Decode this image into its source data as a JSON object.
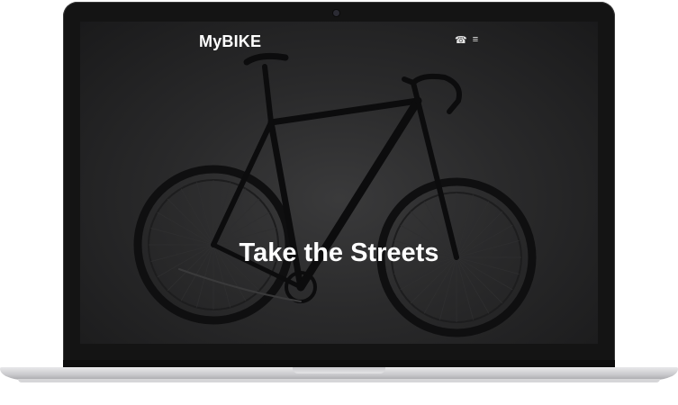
{
  "site": {
    "brand": "MyBIKE",
    "hero_title": "Take the Streets"
  },
  "nav": {
    "phone_icon": "☎",
    "menu_icon": "≡"
  },
  "colors": {
    "screen_bg": "#2a2a2b",
    "text": "#ffffff"
  }
}
